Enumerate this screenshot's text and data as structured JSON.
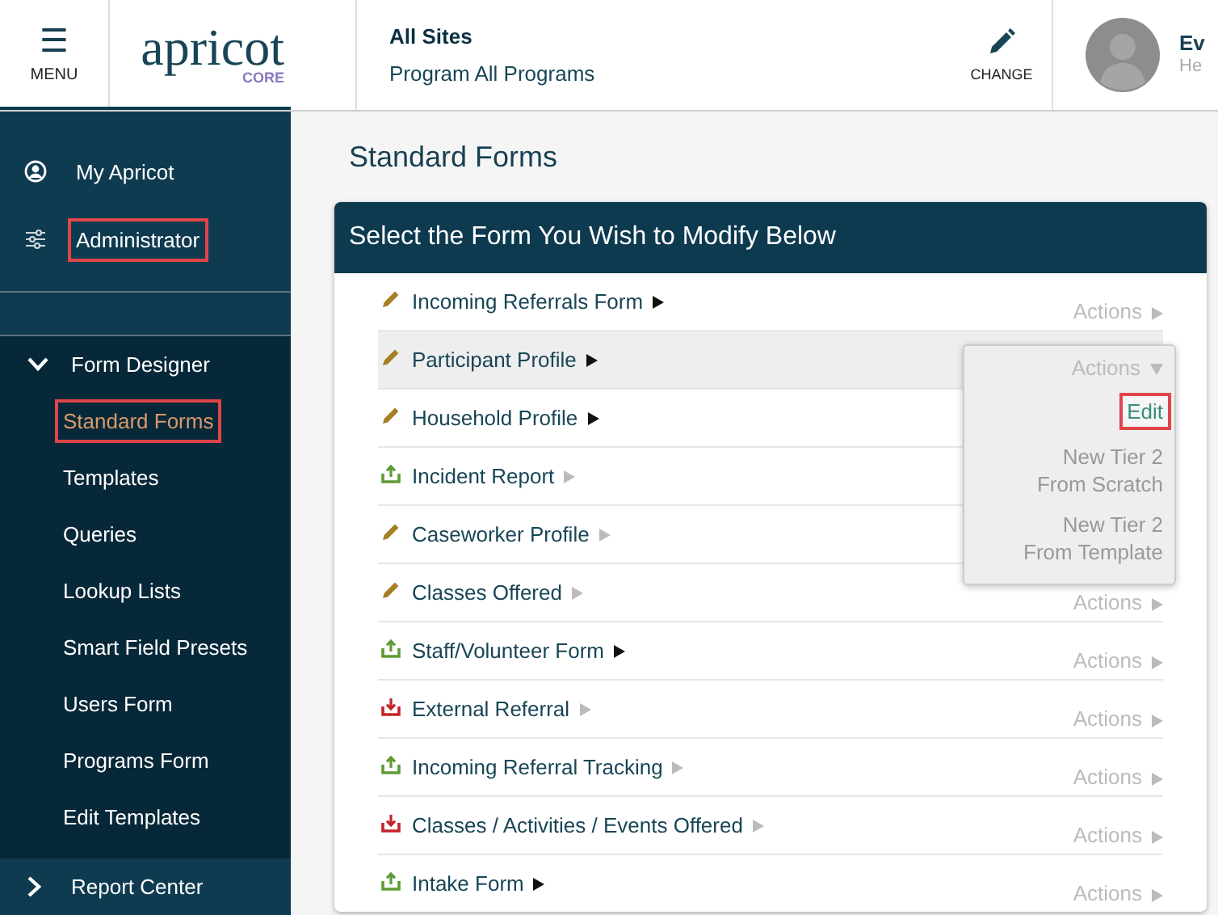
{
  "header": {
    "menu_button": {
      "icon": "☰",
      "label": "MENU"
    },
    "logo": {
      "name": "apricot",
      "edition": "CORE"
    },
    "site": {
      "title": "All Sites",
      "program": "Program All Programs"
    },
    "change_button": {
      "label": "CHANGE"
    },
    "user": {
      "name": "Ev",
      "role": "He"
    }
  },
  "sidebar": {
    "items": [
      {
        "kind": "profile",
        "label": "My Apricot",
        "highlighted": false
      },
      {
        "kind": "admin",
        "label": "Administrator",
        "highlighted": true
      }
    ],
    "sections": [
      {
        "label": "Form Designer",
        "expanded": true,
        "children": [
          {
            "label": "Standard Forms",
            "selected": true,
            "highlighted": true
          },
          {
            "label": "Templates",
            "selected": false,
            "highlighted": false
          },
          {
            "label": "Queries",
            "selected": false,
            "highlighted": false
          },
          {
            "label": "Lookup Lists",
            "selected": false,
            "highlighted": false
          },
          {
            "label": "Smart Field Presets",
            "selected": false,
            "highlighted": false
          },
          {
            "label": "Users Form",
            "selected": false,
            "highlighted": false
          },
          {
            "label": "Programs Form",
            "selected": false,
            "highlighted": false
          },
          {
            "label": "Edit Templates",
            "selected": false,
            "highlighted": false
          }
        ]
      },
      {
        "label": "Report Center",
        "expanded": false
      }
    ]
  },
  "page_title": "Standard Forms",
  "card": {
    "title": "Select the Form You Wish to Modify Below",
    "rows": [
      {
        "kind": "edit",
        "name": "Incoming Referrals Form",
        "enabled": true,
        "selected": false,
        "actions": {
          "label": "Actions",
          "expanded": false
        }
      },
      {
        "kind": "edit",
        "name": "Participant Profile",
        "enabled": true,
        "selected": true,
        "actions": {
          "label": "Actions",
          "expanded": true,
          "menu": [
            {
              "label": "Edit",
              "highlighted": true
            },
            {
              "label": "New Tier 2 From Scratch",
              "highlighted": false
            },
            {
              "label": "New Tier 2 From Template",
              "highlighted": false
            }
          ]
        }
      },
      {
        "kind": "edit",
        "name": "Household Profile",
        "enabled": true,
        "selected": false
      },
      {
        "kind": "upload",
        "name": "Incident Report",
        "enabled": false,
        "selected": false
      },
      {
        "kind": "edit",
        "name": "Caseworker Profile",
        "enabled": false,
        "selected": false
      },
      {
        "kind": "edit",
        "name": "Classes Offered",
        "enabled": false,
        "selected": false,
        "actions": {
          "label": "Actions",
          "expanded": false
        }
      },
      {
        "kind": "upload",
        "name": "Staff/Volunteer Form",
        "enabled": true,
        "selected": false,
        "actions": {
          "label": "Actions",
          "expanded": false
        }
      },
      {
        "kind": "download",
        "name": "External Referral",
        "enabled": false,
        "selected": false,
        "actions": {
          "label": "Actions",
          "expanded": false
        }
      },
      {
        "kind": "upload",
        "name": "Incoming Referral Tracking",
        "enabled": false,
        "selected": false,
        "actions": {
          "label": "Actions",
          "expanded": false
        }
      },
      {
        "kind": "download",
        "name": "Classes / Activities / Events Offered",
        "enabled": false,
        "selected": false,
        "actions": {
          "label": "Actions",
          "expanded": false
        }
      },
      {
        "kind": "upload",
        "name": "Intake Form",
        "enabled": true,
        "selected": false,
        "actions": {
          "label": "Actions",
          "expanded": false
        }
      }
    ]
  }
}
